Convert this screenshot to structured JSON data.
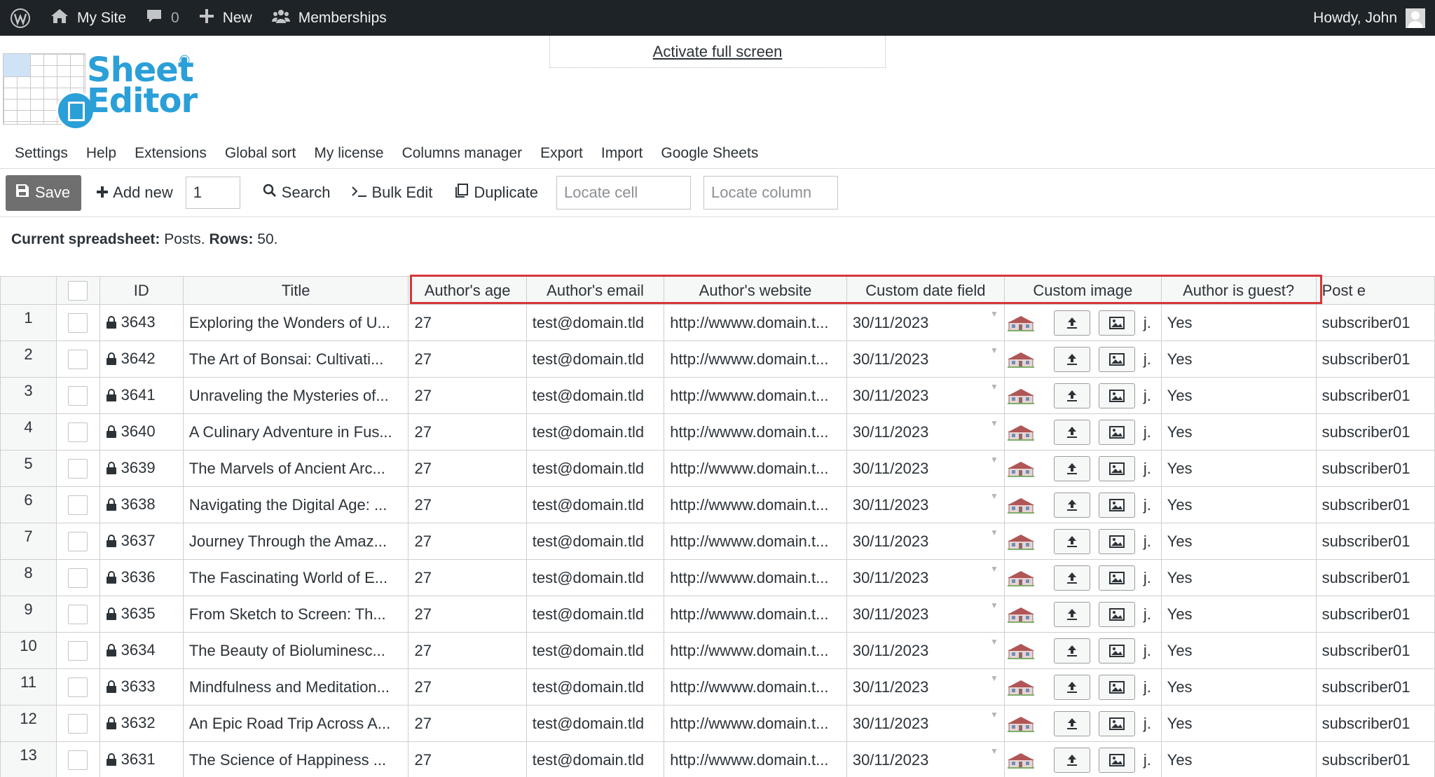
{
  "adminbar": {
    "site": "My Site",
    "comments": "0",
    "new": "New",
    "memberships": "Memberships",
    "howdy": "Howdy, John"
  },
  "header": {
    "fullscreen": "Activate full screen",
    "logo_line1": "Sheet",
    "logo_line2": "Editor",
    "logo_reg": "®"
  },
  "menu": [
    "Settings",
    "Help",
    "Extensions",
    "Global sort",
    "My license",
    "Columns manager",
    "Export",
    "Import",
    "Google Sheets"
  ],
  "toolbar": {
    "save": "Save",
    "add_new": "Add new",
    "add_count": "1",
    "search": "Search",
    "bulk_edit": "Bulk Edit",
    "duplicate": "Duplicate",
    "locate_cell_placeholder": "Locate cell",
    "locate_column_placeholder": "Locate column"
  },
  "status": {
    "label1": "Current spreadsheet:",
    "value1": "Posts.",
    "label2": "Rows:",
    "value2": "50."
  },
  "colors": {
    "highlight": "#d63638",
    "brand": "#2a9fd8",
    "adminbar": "#1d2327"
  },
  "grid": {
    "columns": [
      "ID",
      "Title",
      "Author's age",
      "Author's email",
      "Author's website",
      "Custom date field",
      "Custom image",
      "Author is guest?",
      "Post e"
    ],
    "highlighted_columns": [
      "Author's age",
      "Author's email",
      "Author's website",
      "Custom date field",
      "Custom image",
      "Author is guest?"
    ],
    "image_suffix": "j.",
    "rows": [
      {
        "n": "1",
        "id": "3643",
        "title": "Exploring the Wonders of U...",
        "age": "27",
        "email": "test@domain.tld",
        "website": "http://wwww.domain.t...",
        "date": "30/11/2023",
        "guest": "Yes",
        "post": "subscriber01"
      },
      {
        "n": "2",
        "id": "3642",
        "title": "The Art of Bonsai: Cultivati...",
        "age": "27",
        "email": "test@domain.tld",
        "website": "http://wwww.domain.t...",
        "date": "30/11/2023",
        "guest": "Yes",
        "post": "subscriber01"
      },
      {
        "n": "3",
        "id": "3641",
        "title": "Unraveling the Mysteries of...",
        "age": "27",
        "email": "test@domain.tld",
        "website": "http://wwww.domain.t...",
        "date": "30/11/2023",
        "guest": "Yes",
        "post": "subscriber01"
      },
      {
        "n": "4",
        "id": "3640",
        "title": "A Culinary Adventure in Fus...",
        "age": "27",
        "email": "test@domain.tld",
        "website": "http://wwww.domain.t...",
        "date": "30/11/2023",
        "guest": "Yes",
        "post": "subscriber01"
      },
      {
        "n": "5",
        "id": "3639",
        "title": "The Marvels of Ancient Arc...",
        "age": "27",
        "email": "test@domain.tld",
        "website": "http://wwww.domain.t...",
        "date": "30/11/2023",
        "guest": "Yes",
        "post": "subscriber01"
      },
      {
        "n": "6",
        "id": "3638",
        "title": "Navigating the Digital Age: ...",
        "age": "27",
        "email": "test@domain.tld",
        "website": "http://wwww.domain.t...",
        "date": "30/11/2023",
        "guest": "Yes",
        "post": "subscriber01"
      },
      {
        "n": "7",
        "id": "3637",
        "title": "Journey Through the Amaz...",
        "age": "27",
        "email": "test@domain.tld",
        "website": "http://wwww.domain.t...",
        "date": "30/11/2023",
        "guest": "Yes",
        "post": "subscriber01"
      },
      {
        "n": "8",
        "id": "3636",
        "title": "The Fascinating World of E...",
        "age": "27",
        "email": "test@domain.tld",
        "website": "http://wwww.domain.t...",
        "date": "30/11/2023",
        "guest": "Yes",
        "post": "subscriber01"
      },
      {
        "n": "9",
        "id": "3635",
        "title": "From Sketch to Screen: Th...",
        "age": "27",
        "email": "test@domain.tld",
        "website": "http://wwww.domain.t...",
        "date": "30/11/2023",
        "guest": "Yes",
        "post": "subscriber01"
      },
      {
        "n": "10",
        "id": "3634",
        "title": "The Beauty of Bioluminesc...",
        "age": "27",
        "email": "test@domain.tld",
        "website": "http://wwww.domain.t...",
        "date": "30/11/2023",
        "guest": "Yes",
        "post": "subscriber01"
      },
      {
        "n": "11",
        "id": "3633",
        "title": "Mindfulness and Meditation...",
        "age": "27",
        "email": "test@domain.tld",
        "website": "http://wwww.domain.t...",
        "date": "30/11/2023",
        "guest": "Yes",
        "post": "subscriber01"
      },
      {
        "n": "12",
        "id": "3632",
        "title": "An Epic Road Trip Across A...",
        "age": "27",
        "email": "test@domain.tld",
        "website": "http://wwww.domain.t...",
        "date": "30/11/2023",
        "guest": "Yes",
        "post": "subscriber01"
      },
      {
        "n": "13",
        "id": "3631",
        "title": "The Science of Happiness ...",
        "age": "27",
        "email": "test@domain.tld",
        "website": "http://wwww.domain.t...",
        "date": "30/11/2023",
        "guest": "Yes",
        "post": "subscriber01"
      }
    ]
  }
}
